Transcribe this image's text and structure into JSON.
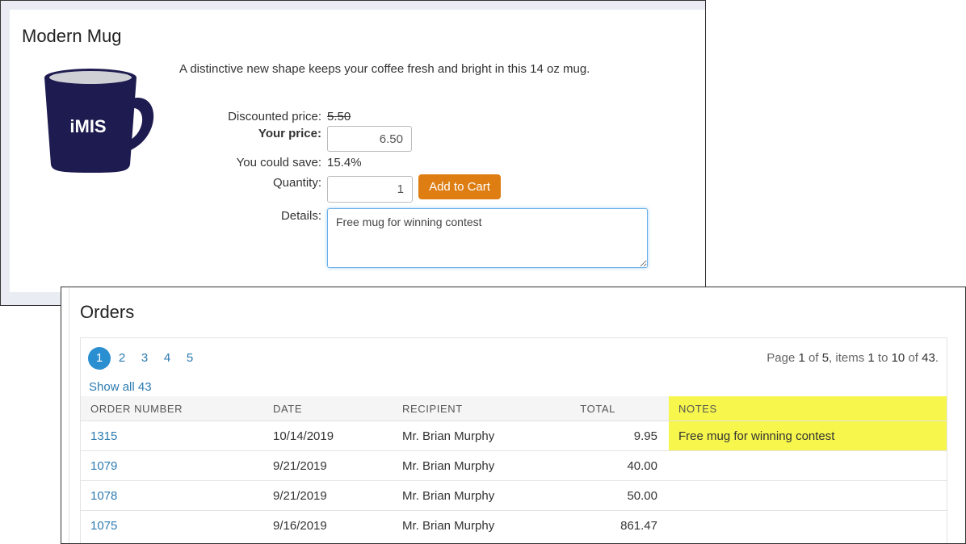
{
  "product": {
    "title": "Modern Mug",
    "logo_text": "iMIS",
    "description": "A distinctive new shape keeps your coffee fresh and bright in this 14 oz mug.",
    "discounted_label": "Discounted price:",
    "discounted_value": "5.50",
    "your_price_label": "Your price:",
    "your_price_value": "6.50",
    "save_label": "You could save:",
    "save_value": "15.4%",
    "quantity_label": "Quantity:",
    "quantity_value": "1",
    "add_to_cart": "Add to Cart",
    "details_label": "Details:",
    "details_value": "Free mug for winning contest"
  },
  "orders": {
    "title": "Orders",
    "pages": [
      "1",
      "2",
      "3",
      "4",
      "5"
    ],
    "active_page": "1",
    "page_info": {
      "prefix": "Page ",
      "page": "1",
      "of_text": " of ",
      "total_pages": "5",
      "items_text": ", items ",
      "from": "1",
      "to_text": " to ",
      "to": "10",
      "of2_text": " of ",
      "total": "43",
      "suffix": "."
    },
    "show_all": "Show all 43",
    "columns": [
      "ORDER NUMBER",
      "DATE",
      "RECIPIENT",
      "TOTAL",
      "NOTES"
    ],
    "rows": [
      {
        "order": "1315",
        "date": "10/14/2019",
        "recipient": "Mr. Brian Murphy",
        "total": "9.95",
        "notes": "Free mug for winning contest"
      },
      {
        "order": "1079",
        "date": "9/21/2019",
        "recipient": "Mr. Brian Murphy",
        "total": "40.00",
        "notes": ""
      },
      {
        "order": "1078",
        "date": "9/21/2019",
        "recipient": "Mr. Brian Murphy",
        "total": "50.00",
        "notes": ""
      },
      {
        "order": "1075",
        "date": "9/16/2019",
        "recipient": "Mr. Brian Murphy",
        "total": "861.47",
        "notes": ""
      }
    ]
  },
  "colors": {
    "mug": "#1d1b4f",
    "button": "#dd7d12",
    "link": "#2d7bb0",
    "highlight": "#f6f64d"
  }
}
